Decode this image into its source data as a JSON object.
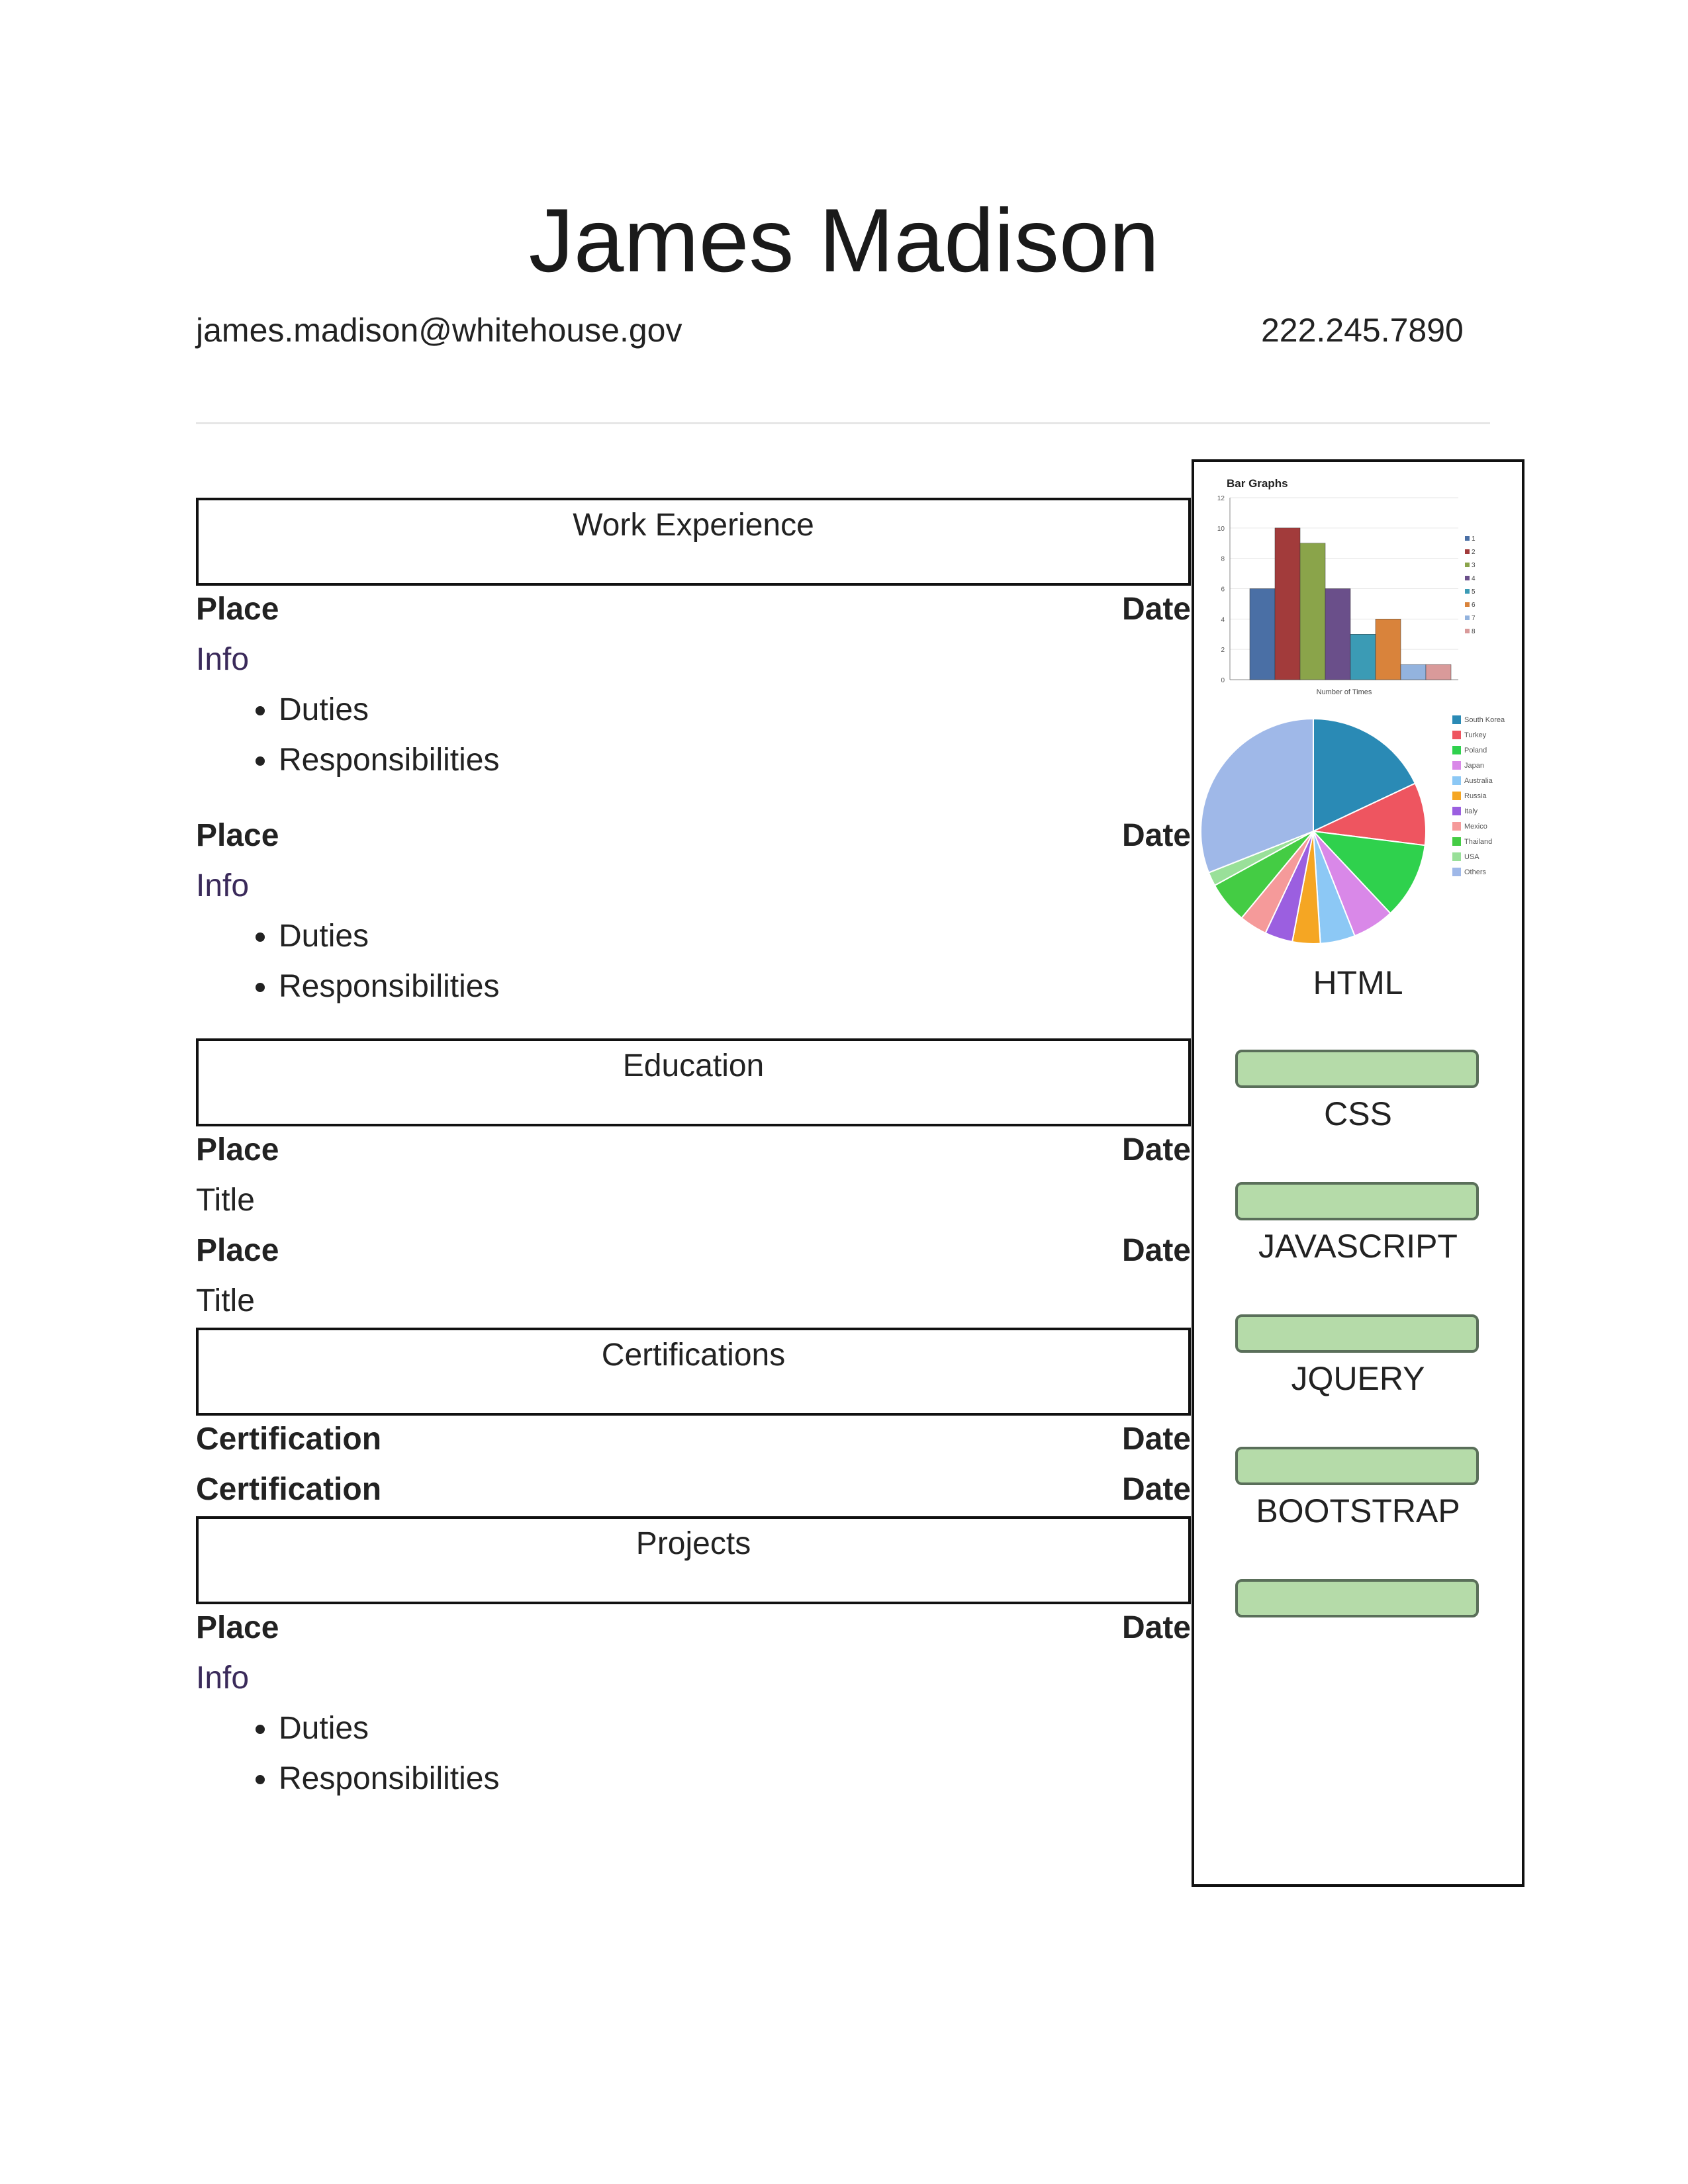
{
  "header": {
    "name": "James Madison",
    "email": "james.madison@whitehouse.gov",
    "phone": "222.245.7890"
  },
  "sections": {
    "work": {
      "title": "Work Experience",
      "entries": [
        {
          "place": "Place",
          "date": "Date",
          "info": "Info",
          "duties": [
            "Duties",
            "Responsibilities"
          ]
        },
        {
          "place": "Place",
          "date": "Date",
          "info": "Info",
          "duties": [
            "Duties",
            "Responsibilities"
          ]
        }
      ]
    },
    "education": {
      "title": "Education",
      "entries": [
        {
          "place": "Place",
          "date": "Date",
          "title": "Title"
        },
        {
          "place": "Place",
          "date": "Date",
          "title": "Title"
        }
      ]
    },
    "certifications": {
      "title": "Certifications",
      "entries": [
        {
          "name": "Certification",
          "date": "Date"
        },
        {
          "name": "Certification",
          "date": "Date"
        }
      ]
    },
    "projects": {
      "title": "Projects",
      "entries": [
        {
          "place": "Place",
          "date": "Date",
          "info": "Info",
          "duties": [
            "Duties",
            "Responsibilities"
          ]
        }
      ]
    }
  },
  "sidebar": {
    "skills": [
      "HTML",
      "CSS",
      "JAVASCRIPT",
      "JQUERY",
      "BOOTSTRAP"
    ],
    "colors": {
      "skill_bar_fill": "#b5dba9",
      "skill_bar_border": "#5a6f5a"
    }
  },
  "chart_data": [
    {
      "type": "bar",
      "title": "Bar Graphs",
      "xlabel": "Number of Times",
      "ylabel": "",
      "ylim": [
        0,
        12
      ],
      "categories": [
        "1",
        "2",
        "3",
        "4",
        "5",
        "6",
        "7",
        "8"
      ],
      "values": [
        6,
        10,
        9,
        6,
        3,
        4,
        1,
        1
      ],
      "colors": [
        "#4a6fa5",
        "#a23b3b",
        "#8aa44a",
        "#6a4f8a",
        "#3b9bb5",
        "#d9833b",
        "#93b3de",
        "#d99a9a"
      ],
      "legend": [
        "1",
        "2",
        "3",
        "4",
        "5",
        "6",
        "7",
        "8"
      ],
      "legend_position": "right",
      "grid": true
    },
    {
      "type": "pie",
      "labels": [
        "South Korea",
        "Turkey",
        "Poland",
        "Japan",
        "Australia",
        "Russia",
        "Italy",
        "Mexico",
        "Thailand",
        "USA",
        "Others"
      ],
      "values": [
        18,
        9,
        11,
        6,
        5,
        4,
        4,
        4,
        6,
        2,
        31
      ],
      "colors": [
        "#2a8ab5",
        "#ee5560",
        "#2fd14d",
        "#d988e8",
        "#8cc8f5",
        "#f5a623",
        "#9b5fe0",
        "#f59a9a",
        "#44cc44",
        "#99e099",
        "#9fb8e8"
      ],
      "legend_position": "right"
    }
  ]
}
